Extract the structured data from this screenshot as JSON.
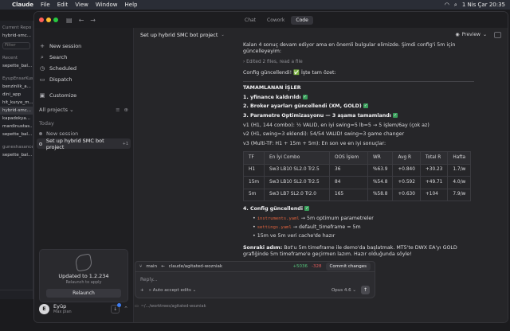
{
  "menubar": {
    "app_name": "Claude",
    "items": [
      "File",
      "Edit",
      "View",
      "Window",
      "Help"
    ],
    "clock": "1 Nis Çar 20:35"
  },
  "background_window": {
    "lines": [
      "Current Repo",
      "hybrid-smc..."
    ],
    "filter_placeholder": "Filter",
    "section_recent": "Recent",
    "recent": [
      "sepette_bal..."
    ],
    "section_user": "EyupEnsarKus",
    "repos": [
      "benzinlik_a...",
      "dini_app",
      "hit_kurye_m...",
      "hybrid-smc...",
      "kapadokya...",
      "mardinustas...",
      "sepette_bal..."
    ],
    "section_org": "guneshasancer",
    "org_repos": [
      "sepette_bal..."
    ]
  },
  "window": {
    "title_tabs": [
      {
        "label": "Chat"
      },
      {
        "label": "Cowork"
      },
      {
        "label": "Code"
      }
    ]
  },
  "sidebar": {
    "nav": [
      {
        "label": "New session",
        "icon": "plus-icon"
      },
      {
        "label": "Search",
        "icon": "search-icon"
      },
      {
        "label": "Scheduled",
        "icon": "clock-icon"
      },
      {
        "label": "Dispatch",
        "icon": "dispatch-icon"
      },
      {
        "label": "Customize",
        "icon": "briefcase-icon"
      }
    ],
    "projects_label": "All projects",
    "today_label": "Today",
    "sessions": [
      {
        "label": "New session"
      },
      {
        "label": "Set up hybrid SMC bot project",
        "meta": "+1"
      }
    ],
    "update": {
      "title": "Updated to 1.2.234",
      "subtitle": "Relaunch to apply",
      "button": "Relaunch"
    },
    "user": {
      "initial": "E",
      "name": "Eyüp",
      "plan": "Max plan"
    }
  },
  "main": {
    "session_title": "Set up hybrid SMC bot project",
    "preview_label": "Preview",
    "intro": "Kalan 4 sonuç devam ediyor ama en önemli bulgular elimizde. Şimdi config'i 5m için güncelleyeyim:",
    "edited": "Edited 2 files, read a file",
    "config_line": "Config güncellendi! ✅ İşte tam özet:",
    "done_header": "TAMAMLANAN İŞLER",
    "done_items": [
      "1. yfinance kaldırıldı",
      "2. Broker ayarları güncellendi (XM, GOLD)",
      "3. Parametre Optimizasyonu — 3 aşama tamamlandı"
    ],
    "v_lines": [
      "v1 (H1, 144 combo): ½ VALID, en iyi swing=5 lb=5 → 5 işlem/6ay (çok az)",
      "v2 (H1, swing=3 eklendi): 54/54 VALID! swing=3 game changer",
      "v3 (Multi-TF: H1 + 15m + 5m): En son ve en iyi sonuçlar:"
    ],
    "table": {
      "headers": [
        "TF",
        "En İyi Combo",
        "OOS İşlem",
        "WR",
        "Avg R",
        "Total R",
        "Hafta"
      ],
      "rows": [
        [
          "H1",
          "Sw3 LB10 SL2.0 Tr2.5",
          "36",
          "%63.9",
          "+0.840",
          "+30.23",
          "1.7/w"
        ],
        [
          "15m",
          "Sw3 LB10 SL2.0 Tr2.5",
          "84",
          "%54.8",
          "+0.592",
          "+49.71",
          "4.0/w"
        ],
        [
          "5m",
          "Sw3 LB7 SL2.0 Tr2.0",
          "165",
          "%58.8",
          "+0.630",
          "+104",
          "7.9/w"
        ]
      ]
    },
    "config_header": "4. Config güncellendi",
    "config_items": [
      {
        "code": "instruments.yaml",
        "text": "→ 5m optimum parametreler"
      },
      {
        "code": "settings.yaml",
        "text": "→ default_timeframe = 5m"
      },
      {
        "code": "",
        "text": "15m ve 5m veri cache'de hazır"
      }
    ],
    "next_label": "Sonraki adım:",
    "next_text": "Bot'u 5m timeframe ile demo'da başlatmak. MT5'te DWX EA'yı GOLD grafiğinde 5m timeframe'e geçirmen lazım. Hazır olduğunda söyle!"
  },
  "gitbar": {
    "branch_base": "main",
    "branch": "claude/agitated-wozniak",
    "additions": "+5036",
    "deletions": "-328",
    "commit_label": "Commit changes"
  },
  "composer": {
    "placeholder": "Reply...",
    "mode": "Auto accept edits",
    "model": "Opus 4.6",
    "path": "~/.../worktrees/agitated-wozniak"
  }
}
